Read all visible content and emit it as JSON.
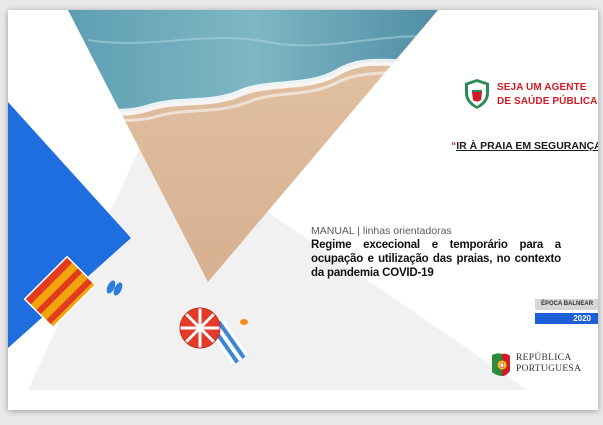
{
  "badge": {
    "line1": "SEJA UM AGENTE",
    "line2": "DE SAÚDE PÚBLICA"
  },
  "quote": {
    "open": "“",
    "text": "IR À PRAIA EM SEGURANÇA",
    "close": "”"
  },
  "manual_label": "MANUAL | linhas orientadoras",
  "title": "Regime excecional e temporário para a ocupação e utilização das praias, no contexto da pandemia COVID-19",
  "season": {
    "label": "ÉPOCA BALNEAR",
    "year": "2020"
  },
  "government": {
    "line1": "REPÚBLICA",
    "line2": "PORTUGUESA"
  },
  "colors": {
    "accent_red": "#d01a24",
    "accent_blue": "#1d5fd6",
    "sand": "#dcb89a",
    "sea": "#6fa6b8"
  }
}
